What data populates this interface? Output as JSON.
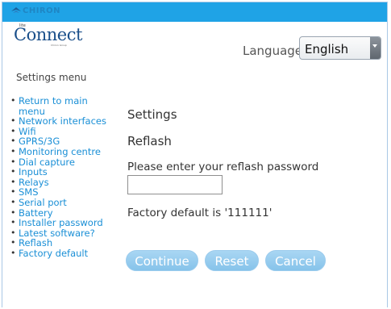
{
  "brand": {
    "name": "CHIRON"
  },
  "logo": {
    "small": "lite",
    "main": "Connect",
    "tag": "Chiron Group"
  },
  "language": {
    "label": "Language:",
    "selected": "English"
  },
  "sidebar": {
    "title": "Settings menu",
    "items": [
      {
        "label": "Return to main menu"
      },
      {
        "label": "Network interfaces"
      },
      {
        "label": "Wifi"
      },
      {
        "label": "GPRS/3G"
      },
      {
        "label": "Monitoring centre"
      },
      {
        "label": "Dial capture"
      },
      {
        "label": "Inputs"
      },
      {
        "label": "Relays"
      },
      {
        "label": "SMS"
      },
      {
        "label": "Serial port"
      },
      {
        "label": "Battery"
      },
      {
        "label": "Installer password"
      },
      {
        "label": "Latest software?"
      },
      {
        "label": "Reflash"
      },
      {
        "label": "Factory default"
      }
    ]
  },
  "main": {
    "title": "Settings",
    "subtitle": "Reflash",
    "prompt": "Please enter your reflash password",
    "password_value": "",
    "default_note": "Factory default is '111111'",
    "buttons": {
      "continue": "Continue",
      "reset": "Reset",
      "cancel": "Cancel"
    }
  },
  "colors": {
    "topbar": "#1fa3e6",
    "link": "#1a8fd6",
    "button": "#86c3ea"
  }
}
